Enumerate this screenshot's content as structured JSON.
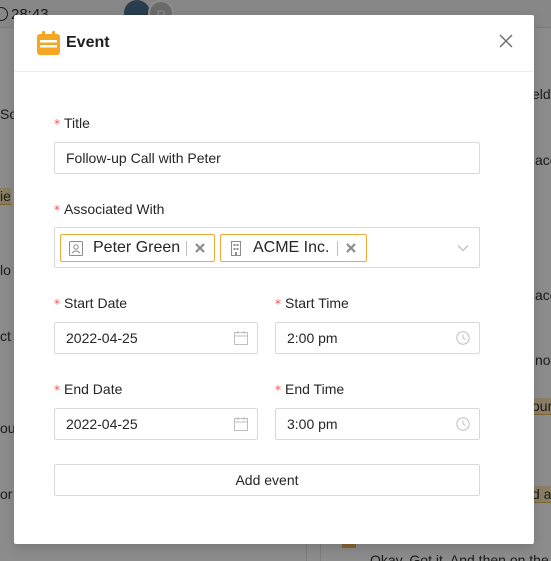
{
  "background": {
    "timer": "28:43",
    "avatar_initial": "P",
    "fragments": [
      "eld",
      "So",
      "acc",
      "ie",
      "lo",
      "acc",
      "ct",
      "not",
      "ou",
      "our",
      "or",
      "d a",
      "Okay. Got it. And then on the"
    ]
  },
  "modal": {
    "title": "Event",
    "fields": {
      "title": {
        "label": "Title",
        "value": "Follow-up Call with Peter"
      },
      "associated_with": {
        "label": "Associated With",
        "tags": [
          {
            "label": "Peter Green",
            "icon": "contact-card-icon"
          },
          {
            "label": "ACME Inc.",
            "icon": "building-icon"
          }
        ]
      },
      "start_date": {
        "label": "Start Date",
        "value": "2022-04-25"
      },
      "start_time": {
        "label": "Start Time",
        "value": "2:00 pm"
      },
      "end_date": {
        "label": "End Date",
        "value": "2022-04-25"
      },
      "end_time": {
        "label": "End Time",
        "value": "3:00 pm"
      }
    },
    "add_button": "Add event"
  },
  "colors": {
    "accent": "#f5a623",
    "tag_border": "#f0a93b",
    "required": "#ff4d4f",
    "overlay": "rgba(0,0,0,0.45)"
  }
}
